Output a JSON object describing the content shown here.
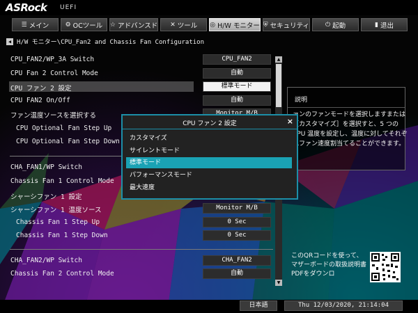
{
  "brand": {
    "logo": "ASRock",
    "sub": "UEFI"
  },
  "tabs": [
    {
      "label": "メイン",
      "icon": "menu-icon"
    },
    {
      "label": "OCツール",
      "icon": "oc-icon"
    },
    {
      "label": "アドバンスド",
      "icon": "star-icon"
    },
    {
      "label": "ツール",
      "icon": "tools-icon"
    },
    {
      "label": "H/W モニター",
      "icon": "monitor-icon",
      "active": true
    },
    {
      "label": "セキュリティ",
      "icon": "shield-icon"
    },
    {
      "label": "起動",
      "icon": "power-icon"
    },
    {
      "label": "退出",
      "icon": "exit-icon"
    }
  ],
  "breadcrumb": "H/W モニター\\CPU_Fan2 and Chassis Fan Configuration",
  "settings": [
    {
      "label": "CPU_FAN2/WP_3A Switch",
      "value": "CPU_FAN2"
    },
    {
      "label": "CPU Fan 2 Control Mode",
      "value": "自動"
    },
    {
      "label": "CPU ファン 2 設定",
      "value": "標準モード",
      "selected": true
    },
    {
      "label": "CPU FAN2 On/Off",
      "value": "自動"
    },
    {
      "label": "ファン温度ソースを選択する",
      "value": "Monitor M/B"
    },
    {
      "label": "CPU Optional Fan Step Up",
      "value": ""
    },
    {
      "label": "CPU Optional Fan Step Down",
      "value": ""
    },
    {
      "label": "CHA_FAN1/WP Switch",
      "value": ""
    },
    {
      "label": "Chassis Fan 1 Control Mode",
      "value": ""
    },
    {
      "label": "シャーシファン 1 設定",
      "value": ""
    },
    {
      "label": "シャーシファン 1 温度ソース",
      "value": "Monitor M/B"
    },
    {
      "label": "Chassis Fan 1 Step Up",
      "value": "0 Sec"
    },
    {
      "label": "Chassis Fan 1 Step Down",
      "value": "0 Sec"
    },
    {
      "label": "CHA_FAN2/WP Switch",
      "value": "CHA_FAN2"
    },
    {
      "label": "Chassis Fan 2 Control Mode",
      "value": "自動"
    }
  ],
  "description": {
    "title": "説明",
    "text": "ァンのファンモードを選択しますまたは［カスタマイズ］を選択すと、5 つの CPU 温度を設定し、温度に対してそれぞれファン速度割当てることができます。"
  },
  "qr_text": "このQRコードを使って、マザーボードの取扱説明書PDFをダウンロ",
  "dialog": {
    "title": "CPU ファン 2 設定",
    "close": "×",
    "options": [
      "カスタマイズ",
      "サイレントモード",
      "標準モード",
      "パフォーマンスモード",
      "最大速度"
    ],
    "selected_index": 2
  },
  "footer": {
    "language": "日本語",
    "datetime": "Thu 12/03/2020, 21:14:04"
  },
  "colors": {
    "accent": "#1aa2b4",
    "selected_bg": "#f2f2f2"
  }
}
